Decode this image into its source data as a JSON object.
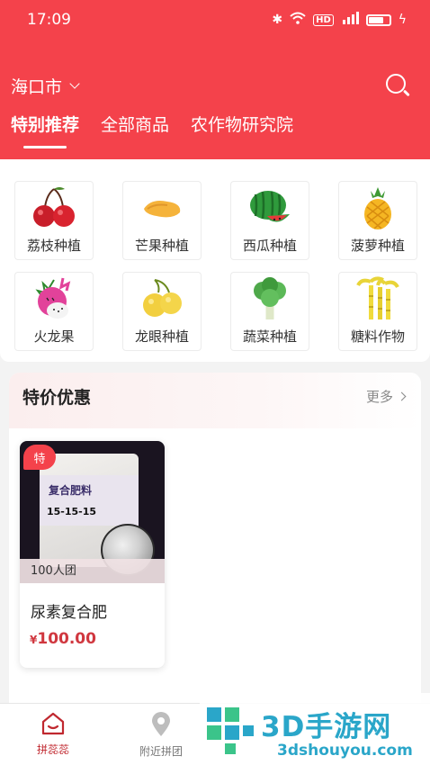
{
  "status_bar": {
    "time": "17:09",
    "icons": [
      "bluetooth-icon",
      "wifi-icon",
      "hd-icon",
      "signal-icon",
      "battery-icon",
      "charging-icon"
    ],
    "hd_label": "HD"
  },
  "header": {
    "city": "海口市",
    "tabs": [
      {
        "label": "特别推荐",
        "active": true
      },
      {
        "label": "全部商品",
        "active": false
      },
      {
        "label": "农作物研究院",
        "active": false
      }
    ],
    "accent_color": "#f4424b"
  },
  "categories": [
    {
      "label": "荔枝种植",
      "icon": "lychee-icon"
    },
    {
      "label": "芒果种植",
      "icon": "mango-icon"
    },
    {
      "label": "西瓜种植",
      "icon": "watermelon-icon"
    },
    {
      "label": "菠萝种植",
      "icon": "pineapple-icon"
    },
    {
      "label": "火龙果",
      "icon": "dragon-fruit-icon"
    },
    {
      "label": "龙眼种植",
      "icon": "longan-icon"
    },
    {
      "label": "蔬菜种植",
      "icon": "vegetable-icon"
    },
    {
      "label": "糖料作物",
      "icon": "sugarcane-icon"
    }
  ],
  "promo": {
    "title": "特价优惠",
    "more_label": "更多",
    "product": {
      "badge": "特",
      "group_text": "100人团",
      "name": "尿素复合肥",
      "currency": "¥",
      "price": "100.00",
      "image_text": "复合肥料",
      "image_formula": "15-15-15"
    }
  },
  "bottom_nav": {
    "items": [
      {
        "label": "拼蕊蕊",
        "icon": "home-icon",
        "active": true
      },
      {
        "label": "附近拼团",
        "icon": "location-pin-icon",
        "active": false
      }
    ]
  },
  "watermark": {
    "brand": "3D手游网",
    "url": "3dshouyou.com"
  }
}
